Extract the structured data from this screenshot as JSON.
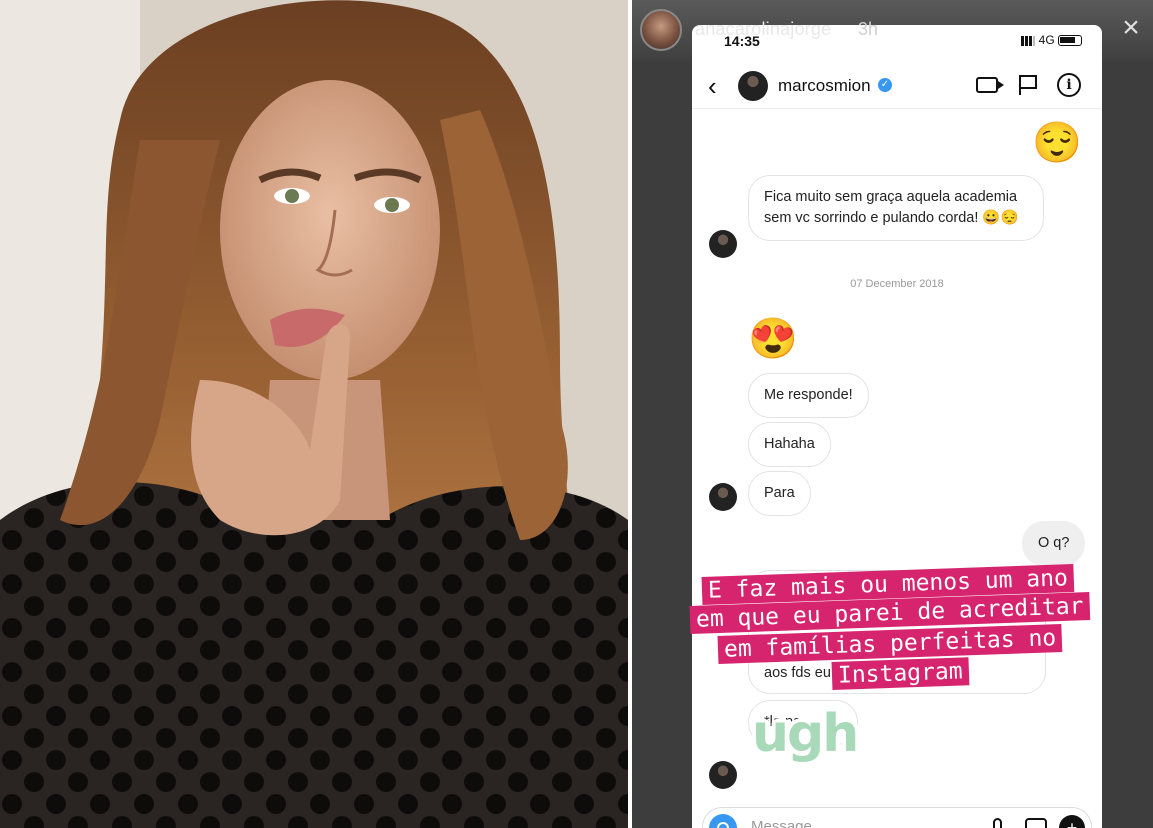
{
  "story": {
    "username": "anacarolinajorge",
    "time_ago": "3h",
    "close_glyph": "×"
  },
  "status_bar": {
    "time": "14:35",
    "network": "4G"
  },
  "chat": {
    "contact_name": "marcosmion",
    "verified_glyph": "✓",
    "back_glyph": "‹",
    "info_glyph": "i",
    "date_separator": "07 December 2018",
    "messages": [
      {
        "from": "me",
        "text": "😌"
      },
      {
        "from": "them",
        "text": "Fica muito sem graça aquela academia sem vc sorrindo e pulando corda! 😀😔"
      },
      {
        "from": "them",
        "text": "😍"
      },
      {
        "from": "them",
        "text": "Me responde!"
      },
      {
        "from": "them",
        "text": "Hahaha"
      },
      {
        "from": "them",
        "text": "Para"
      },
      {
        "from": "me",
        "text": "O q?"
      },
      {
        "from": "them",
        "text": "aos fds eu"
      },
      {
        "from": "them",
        "text": "*la pa"
      }
    ],
    "composer_placeholder": "Message",
    "sticker_glyph": "+"
  },
  "caption": {
    "lines": [
      "E faz mais ou menos um ano",
      "em que eu parei de acreditar",
      "em famílias perfeitas no",
      "Instagram"
    ],
    "sticker_text": "ugh",
    "highlight_color": "#d6246e"
  }
}
